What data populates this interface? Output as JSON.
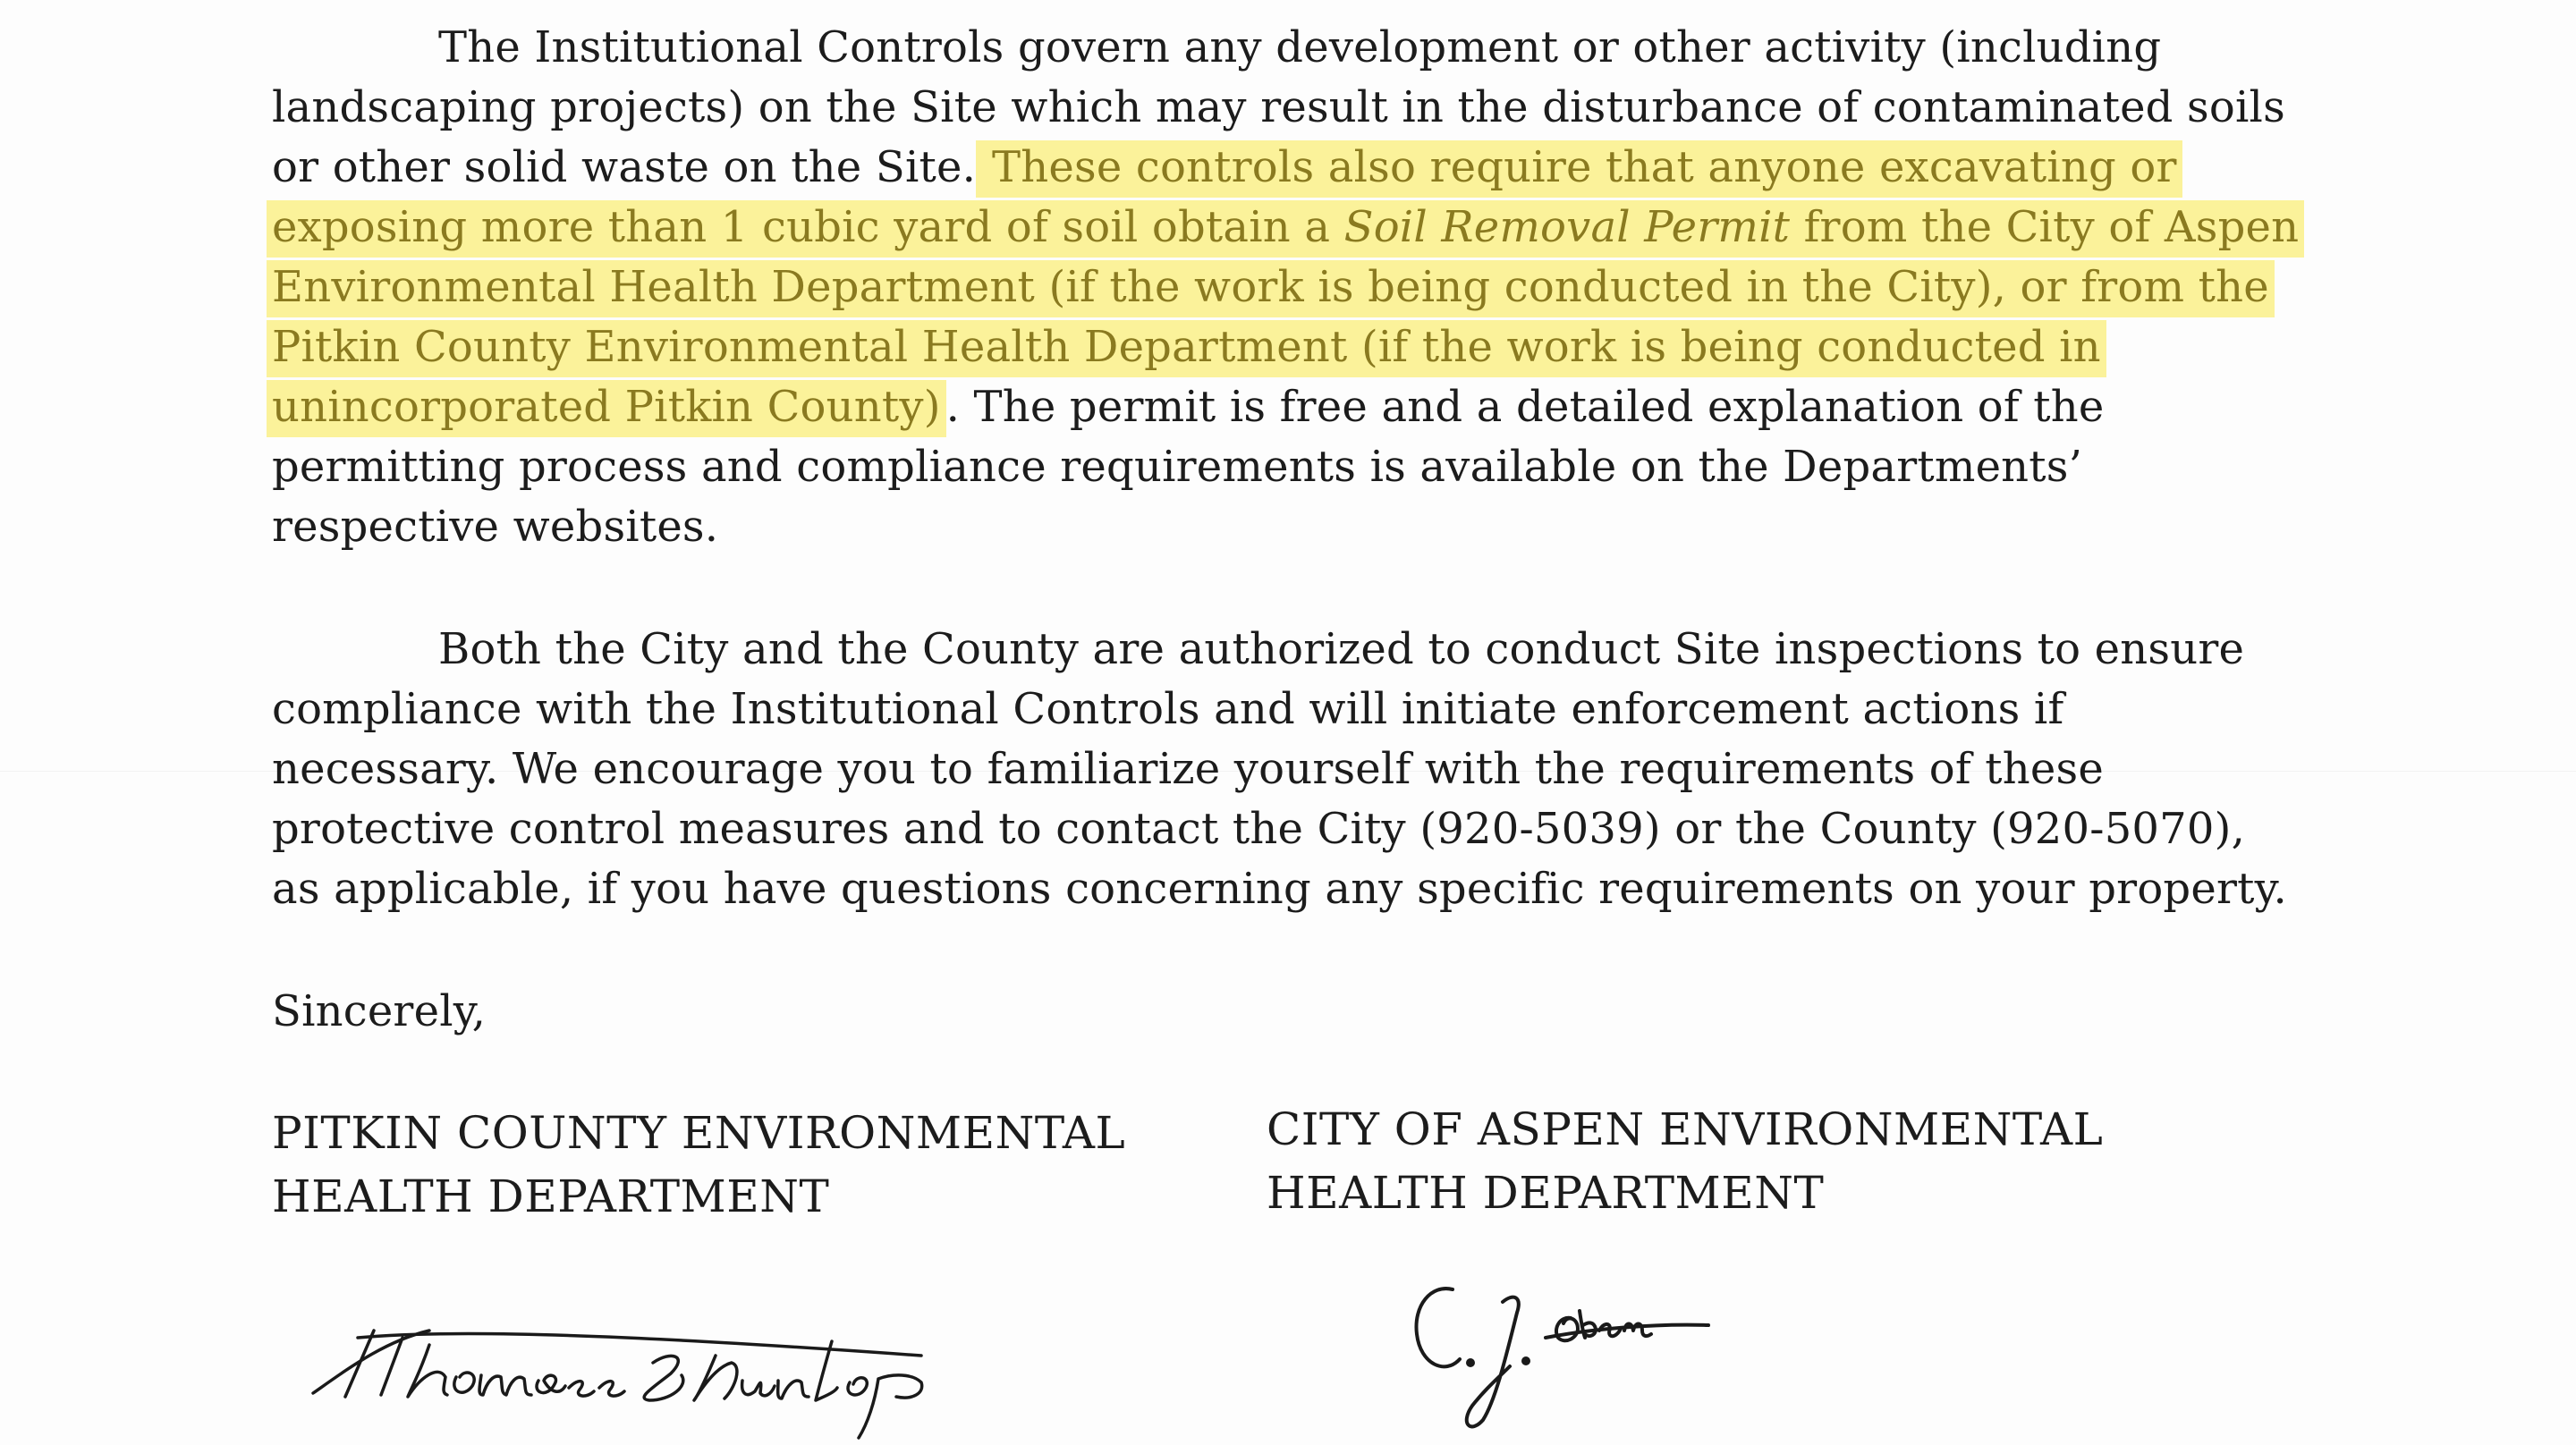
{
  "letter": {
    "para1": {
      "line1": "The Institutional Controls govern any development or other activity (including",
      "line2": "landscaping projects) on the Site which may result in the disturbance of contaminated soils",
      "line3_plain": "or other solid waste on the Site.",
      "line3_hl": "These controls also require that anyone excavating or",
      "line4_hl_a": "exposing more than 1 cubic yard of soil obtain a ",
      "line4_hl_italic": "Soil Removal Permit",
      "line4_hl_b": " from the City of Aspen",
      "line5_hl": "Environmental Health Department (if the work is being conducted in the City), or from the",
      "line6_hl": "Pitkin County Environmental Health Department (if the work is being conducted in",
      "line7_hl": "unincorporated Pitkin County)",
      "line7_plain": ".  The permit is free and a detailed explanation of the",
      "line8": "permitting process and compliance requirements is available on the Departments’",
      "line9": "respective websites."
    },
    "para2": {
      "line1": "Both the City and the County are authorized to conduct Site inspections to ensure",
      "line2": "compliance with the Institutional Controls and will initiate enforcement actions if",
      "line3": "necessary.  We encourage you to familiarize yourself with the requirements of these",
      "line4": "protective control measures and to contact the City (920-5039) or the County (920-5070),",
      "line5": "as applicable, if you have questions concerning any specific requirements on your property."
    },
    "closing": "Sincerely,",
    "signatory_left": {
      "line1": "PITKIN COUNTY ENVIRONMENTAL",
      "line2": "HEALTH DEPARTMENT"
    },
    "signatory_right": {
      "line1": "CITY OF ASPEN ENVIRONMENTAL",
      "line2": "HEALTH DEPARTMENT"
    }
  },
  "colors": {
    "highlight": "#fbf29a",
    "highlight_text": "#8a7a20",
    "text": "#1c1c1c"
  }
}
